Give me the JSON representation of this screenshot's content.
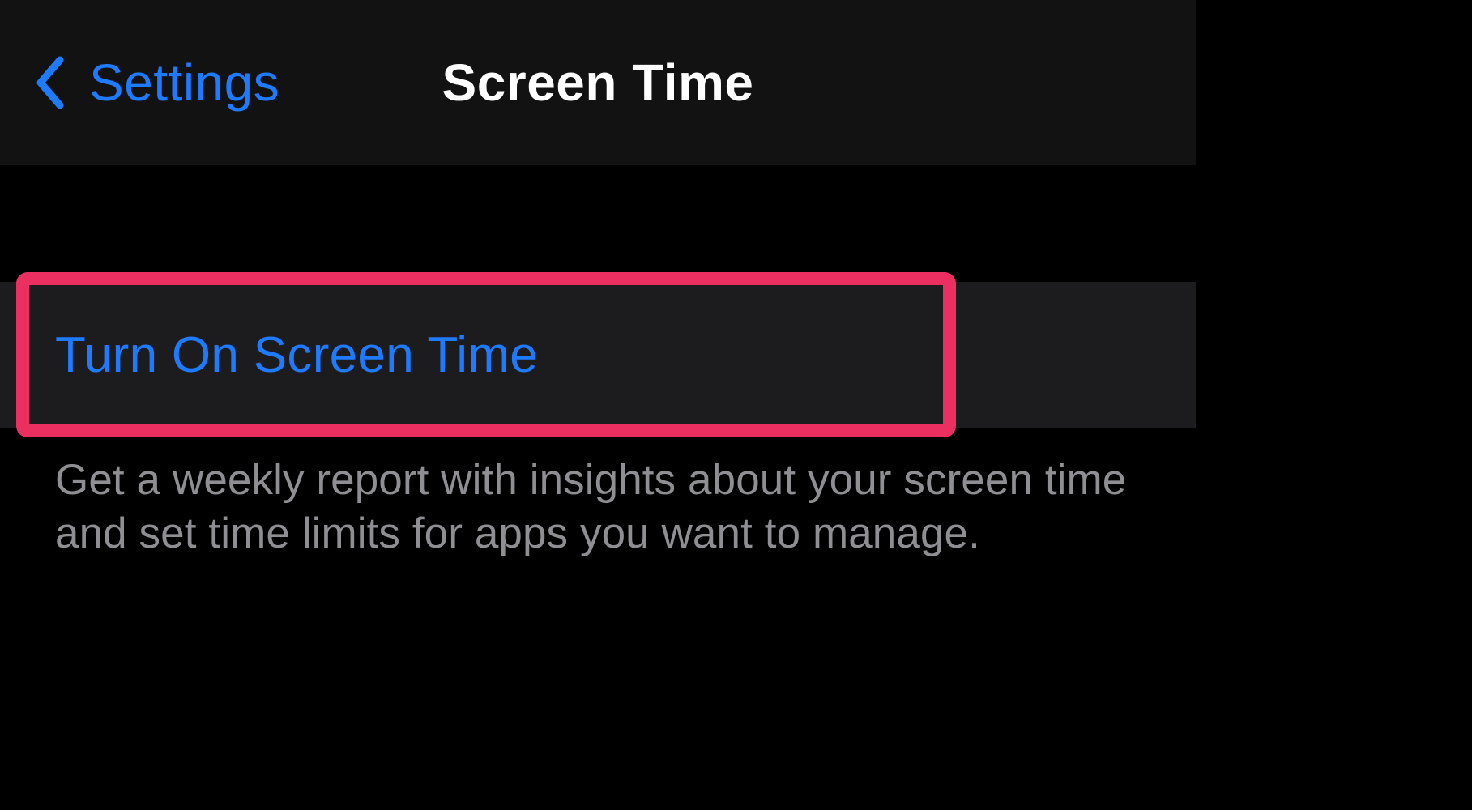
{
  "colors": {
    "accent_blue": "#1e7bff",
    "highlight_pink": "#ec2f61",
    "cell_bg": "#1c1c1e",
    "nav_bg": "#121212",
    "title_white": "#ffffff",
    "footer_gray": "#8f8f93"
  },
  "nav": {
    "back_label": "Settings",
    "title": "Screen Time"
  },
  "main": {
    "turn_on_label": "Turn On Screen Time",
    "footer_description": "Get a weekly report with insights about your screen time and set time limits for apps you want to manage."
  }
}
